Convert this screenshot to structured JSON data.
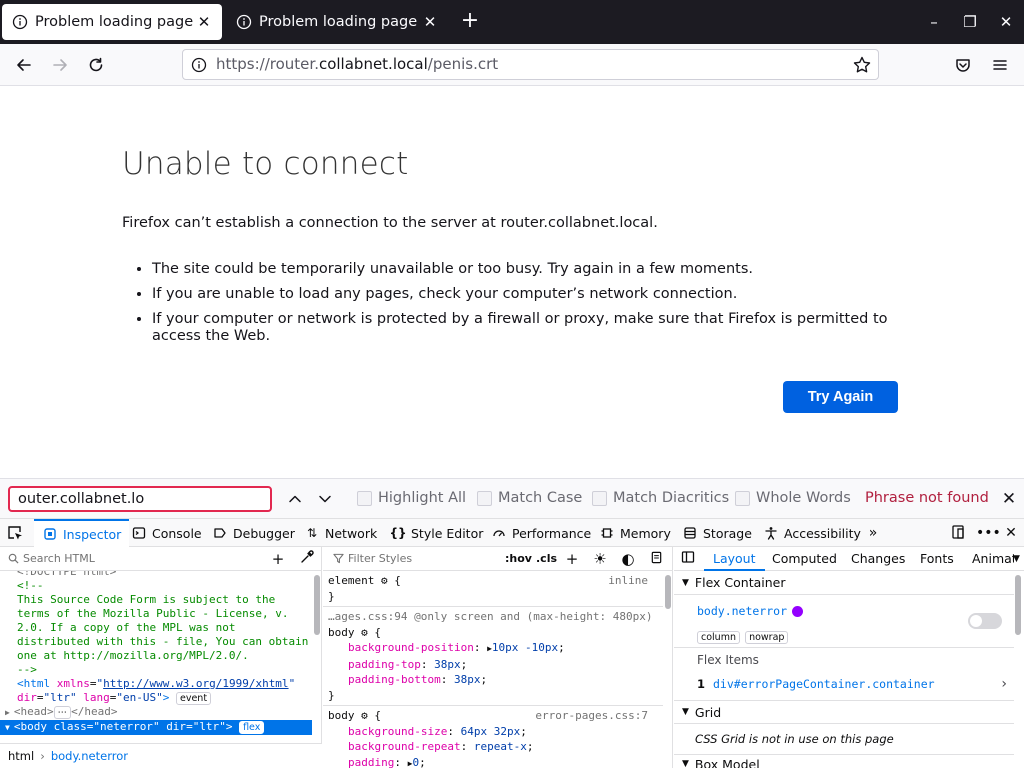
{
  "tabs": [
    {
      "label": "Problem loading page",
      "active": true
    },
    {
      "label": "Problem loading page",
      "active": false
    }
  ],
  "window_controls": {
    "minimize": "–",
    "restore": "❐",
    "close": "✕"
  },
  "urlbar": {
    "scheme": "https://router.",
    "host": "collabnet.local",
    "path": "/penis.crt"
  },
  "page": {
    "title": "Unable to connect",
    "description": "Firefox can’t establish a connection to the server at router.collabnet.local.",
    "bullets": [
      "The site could be temporarily unavailable or too busy. Try again in a few moments.",
      "If you are unable to load any pages, check your computer’s network connection.",
      "If your computer or network is protected by a firewall or proxy, make sure that Firefox is permitted to access the Web."
    ],
    "try_again": "Try Again"
  },
  "findbar": {
    "value": "outer.collabnet.lo",
    "options": [
      "Highlight All",
      "Match Case",
      "Match Diacritics",
      "Whole Words"
    ],
    "status": "Phrase not found"
  },
  "devtools": {
    "tabs": [
      {
        "label": "Inspector",
        "icon": "inspector-icon",
        "selected": true
      },
      {
        "label": "Console",
        "icon": "console-icon",
        "selected": false
      },
      {
        "label": "Debugger",
        "icon": "debugger-icon",
        "selected": false
      },
      {
        "label": "Network",
        "icon": "network-icon",
        "selected": false
      },
      {
        "label": "Style Editor",
        "icon": "style-editor-icon",
        "selected": false
      },
      {
        "label": "Performance",
        "icon": "performance-icon",
        "selected": false
      },
      {
        "label": "Memory",
        "icon": "memory-icon",
        "selected": false
      },
      {
        "label": "Storage",
        "icon": "storage-icon",
        "selected": false
      },
      {
        "label": "Accessibility",
        "icon": "accessibility-icon",
        "selected": false
      }
    ],
    "html_pane": {
      "search_placeholder": "Search HTML",
      "doctype": "<!DOCTYPE html>",
      "comment_open": "<!--",
      "comment_text": "This Source Code Form is subject to the terms of the Mozilla Public - License, v. 2.0. If a copy of the MPL was not distributed with this - file, You can obtain one at http://mozilla.org/MPL/2.0/.",
      "comment_close": "-->",
      "html_tag": "<html",
      "html_attr1_name": "xmlns",
      "html_attr1_val": "http://www.w3.org/1999/xhtml",
      "html_attr2_name": "dir",
      "html_attr2_val": "ltr",
      "html_attr3_name": "lang",
      "html_attr3_val": "en-US",
      "event_badge": "event",
      "head_open": "<head>",
      "head_close": "</head>",
      "ellipsis_badge": "⋯",
      "body_tag": "<body",
      "body_attr1_name": "class",
      "body_attr1_val": "neterror",
      "body_attr2_name": "dir",
      "body_attr2_val": "ltr",
      "flex_badge": "flex",
      "breadcrumbs": [
        "html",
        "body.neterror"
      ]
    },
    "rules_pane": {
      "filter_placeholder": "Filter Styles",
      "hov": ":hov",
      "cls": ".cls",
      "rules": [
        {
          "selector": "element",
          "source": "inline",
          "props": []
        },
        {
          "media": "…ages.css:94 @only screen and (max-height: 480px)",
          "selector": "body",
          "source": "",
          "props": [
            {
              "name": "background-position",
              "value": "10px -10px",
              "expander": true
            },
            {
              "name": "padding-top",
              "value": "38px",
              "expander": false
            },
            {
              "name": "padding-bottom",
              "value": "38px",
              "expander": false
            }
          ]
        },
        {
          "selector": "body",
          "source": "error-pages.css:7",
          "props": [
            {
              "name": "background-size",
              "value": "64px 32px",
              "expander": false
            },
            {
              "name": "background-repeat",
              "value": "repeat-x",
              "expander": false
            },
            {
              "name": "padding",
              "value": "0",
              "expander": true
            }
          ]
        }
      ]
    },
    "layout_pane": {
      "tabs": [
        "Layout",
        "Computed",
        "Changes",
        "Fonts",
        "Animat"
      ],
      "flex_container_heading": "Flex Container",
      "flex_container_name": "body.neterror",
      "flex_badges": [
        "column",
        "nowrap"
      ],
      "flex_items_heading": "Flex Items",
      "flex_item_index": "1",
      "flex_item_selector": "div#errorPageContainer.container",
      "grid_heading": "Grid",
      "grid_note": "CSS Grid is not in use on this page",
      "box_model_heading": "Box Model"
    }
  }
}
